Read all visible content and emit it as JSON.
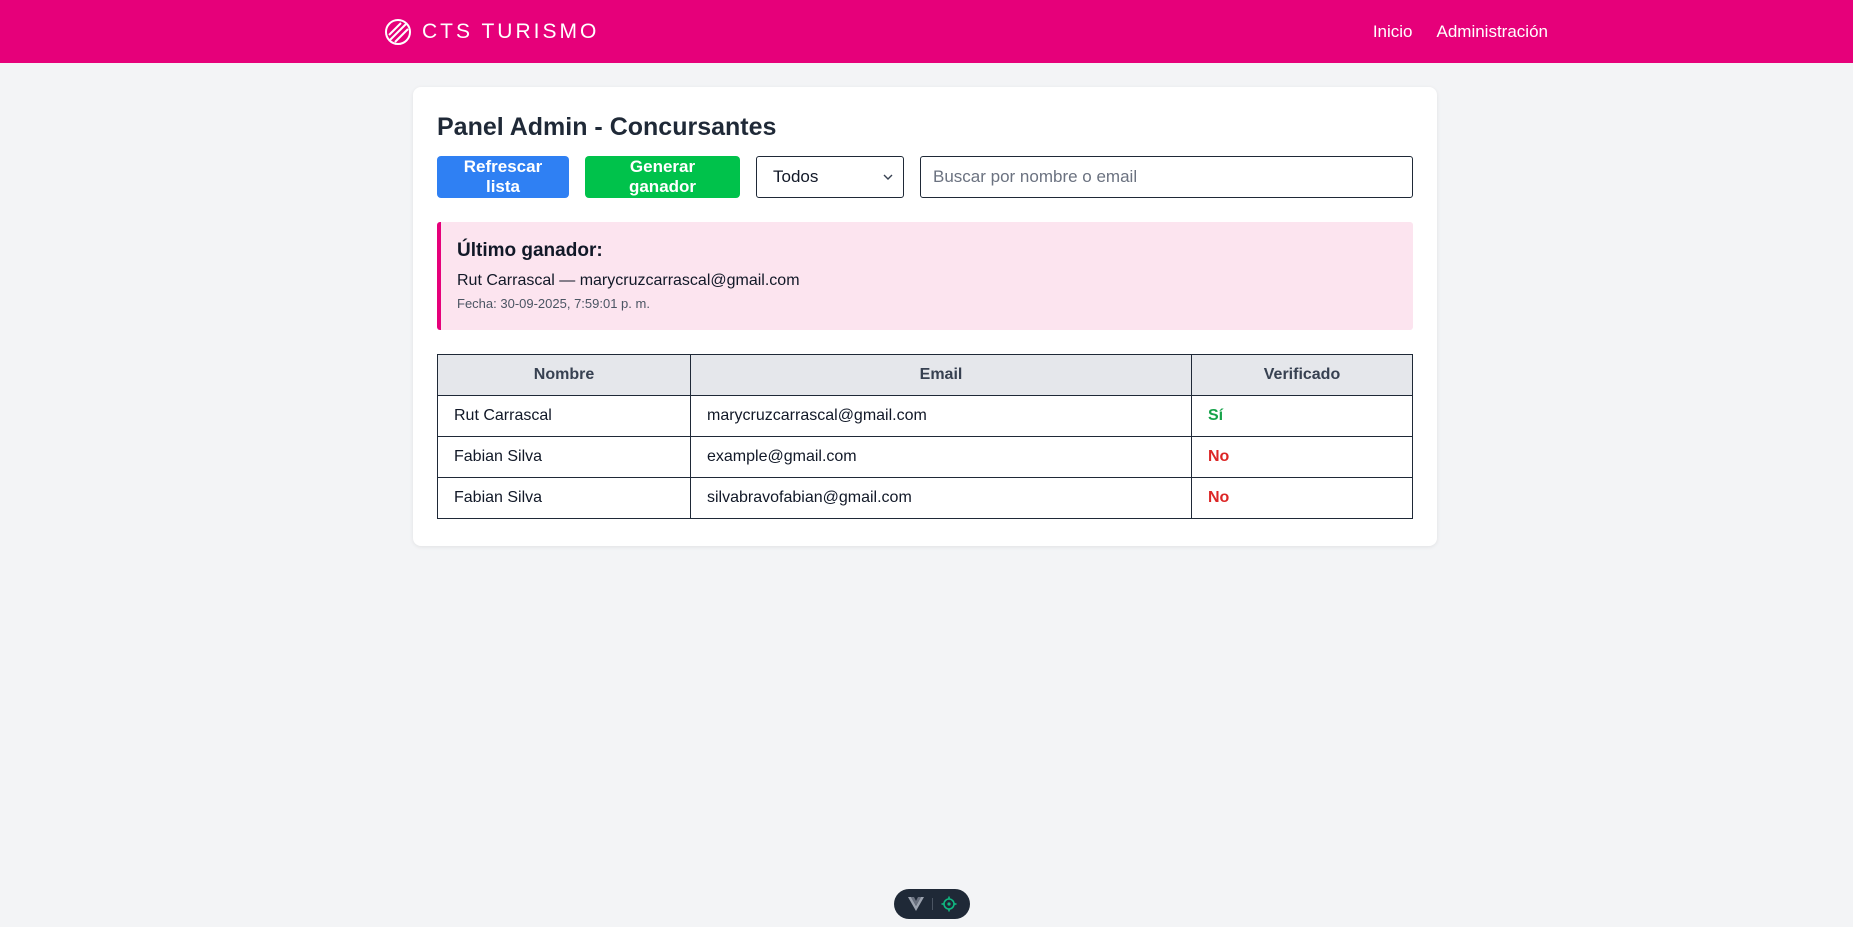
{
  "header": {
    "brand": "CTS TURISMO",
    "nav": [
      {
        "label": "Inicio"
      },
      {
        "label": "Administración"
      }
    ]
  },
  "panel": {
    "title": "Panel Admin - Concursantes",
    "refresh_label": "Refrescar lista",
    "generate_label": "Generar ganador",
    "filter_value": "Todos",
    "search_placeholder": "Buscar por nombre o email",
    "search_value": ""
  },
  "winner": {
    "title": "Último ganador:",
    "line": "Rut Carrascal — marycruzcarrascal@gmail.com",
    "date": "Fecha: 30-09-2025, 7:59:01 p. m."
  },
  "table": {
    "headers": [
      "Nombre",
      "Email",
      "Verificado"
    ],
    "rows": [
      {
        "nombre": "Rut Carrascal",
        "email": "marycruzcarrascal@gmail.com",
        "verificado": "Sí"
      },
      {
        "nombre": "Fabian Silva",
        "email": "example@gmail.com",
        "verificado": "No"
      },
      {
        "nombre": "Fabian Silva",
        "email": "silvabravofabian@gmail.com",
        "verificado": "No"
      }
    ]
  },
  "colors": {
    "brand": "#e6007a",
    "primary_button": "#2f80f3",
    "success_button": "#00c24b",
    "verified_yes": "#16a34a",
    "verified_no": "#dc2626"
  },
  "icons": {
    "brand_logo": "striped-globe-icon",
    "select_arrow": "chevron-down-icon",
    "devtools": [
      "vue-logo-icon",
      "target-icon"
    ]
  }
}
